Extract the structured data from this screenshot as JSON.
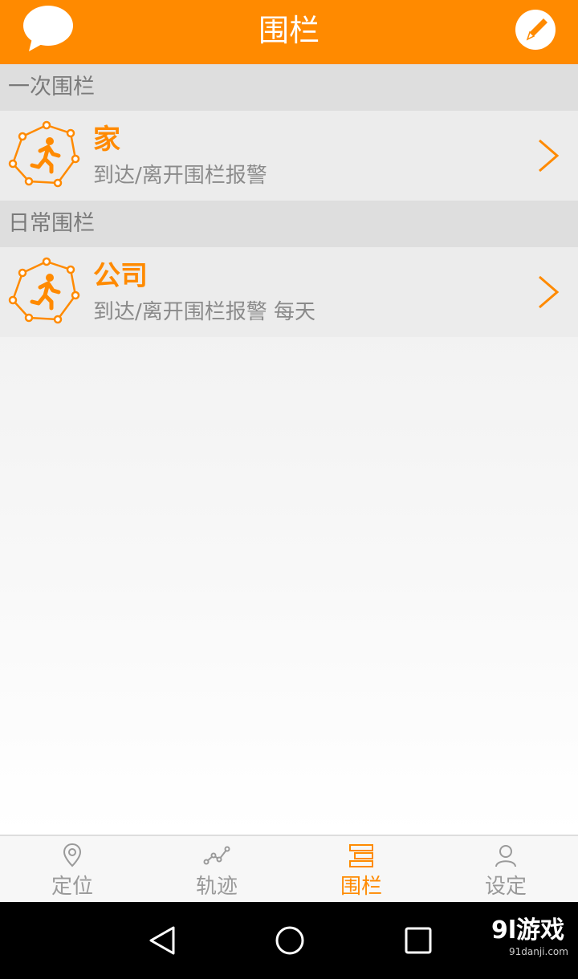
{
  "header": {
    "title": "围栏",
    "message_icon": "chat-bubble-icon",
    "edit_icon": "edit-pencil-icon"
  },
  "sections": [
    {
      "title": "一次围栏",
      "items": [
        {
          "name": "家",
          "desc": "到达/离开围栏报警"
        }
      ]
    },
    {
      "title": "日常围栏",
      "items": [
        {
          "name": "公司",
          "desc": "到达/离开围栏报警 每天"
        }
      ]
    }
  ],
  "tabbar": {
    "tabs": [
      {
        "label": "定位",
        "icon": "location-pin-icon",
        "active": false
      },
      {
        "label": "轨迹",
        "icon": "track-line-icon",
        "active": false
      },
      {
        "label": "围栏",
        "icon": "fence-icon",
        "active": true
      },
      {
        "label": "设定",
        "icon": "user-icon",
        "active": false
      }
    ]
  },
  "system_nav": {
    "buttons": [
      "back-icon",
      "home-icon",
      "recents-icon"
    ]
  },
  "watermark": {
    "main": "9l游戏",
    "sub": "91danji.com"
  },
  "colors": {
    "accent": "#ff8a00",
    "section_bg": "#dedede",
    "item_bg": "#ececec",
    "inactive_text": "#9a9a9a"
  }
}
